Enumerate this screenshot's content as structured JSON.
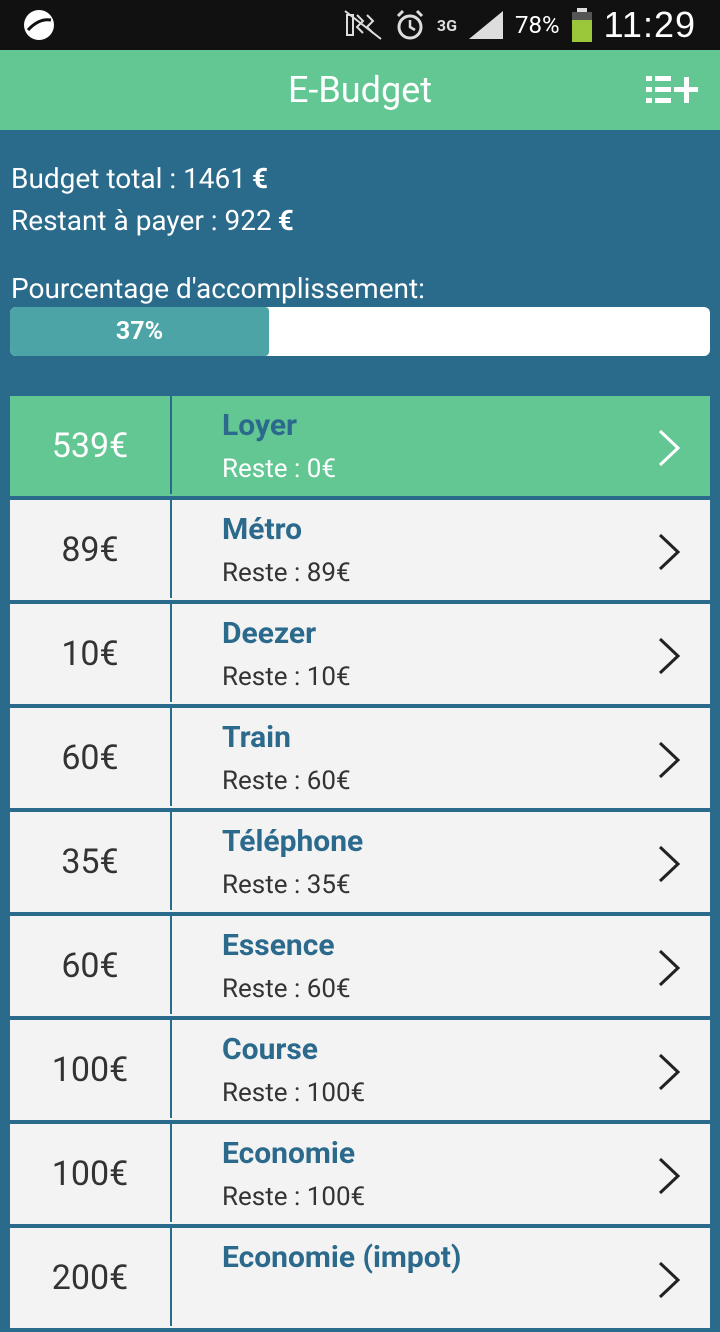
{
  "status_bar": {
    "battery_percent": "78%",
    "network": "3G",
    "time": "11:29"
  },
  "app": {
    "title": "E-Budget"
  },
  "summary": {
    "budget_total_label": "Budget total : 1461",
    "restant_label": "Restant à payer : 922",
    "currency_symbol": "€",
    "progress_label": "Pourcentage d'accomplissement:",
    "progress_value": 0.37,
    "progress_text": "37%"
  },
  "items": [
    {
      "amount": "539€",
      "name": "Loyer",
      "rest": "Reste : 0€",
      "paid": true
    },
    {
      "amount": "89€",
      "name": "Métro",
      "rest": "Reste : 89€",
      "paid": false
    },
    {
      "amount": "10€",
      "name": "Deezer",
      "rest": "Reste : 10€",
      "paid": false
    },
    {
      "amount": "60€",
      "name": "Train",
      "rest": "Reste : 60€",
      "paid": false
    },
    {
      "amount": "35€",
      "name": "Téléphone",
      "rest": "Reste : 35€",
      "paid": false
    },
    {
      "amount": "60€",
      "name": "Essence",
      "rest": "Reste : 60€",
      "paid": false
    },
    {
      "amount": "100€",
      "name": "Course",
      "rest": "Reste : 100€",
      "paid": false
    },
    {
      "amount": "100€",
      "name": "Economie",
      "rest": "Reste : 100€",
      "paid": false
    },
    {
      "amount": "200€",
      "name": "Economie (impot)",
      "rest": "",
      "paid": false
    }
  ],
  "colors": {
    "accent_green": "#63c794",
    "background_blue": "#2a6a8a",
    "progress_fill": "#4da4a6",
    "item_title": "#2b6a8c"
  }
}
